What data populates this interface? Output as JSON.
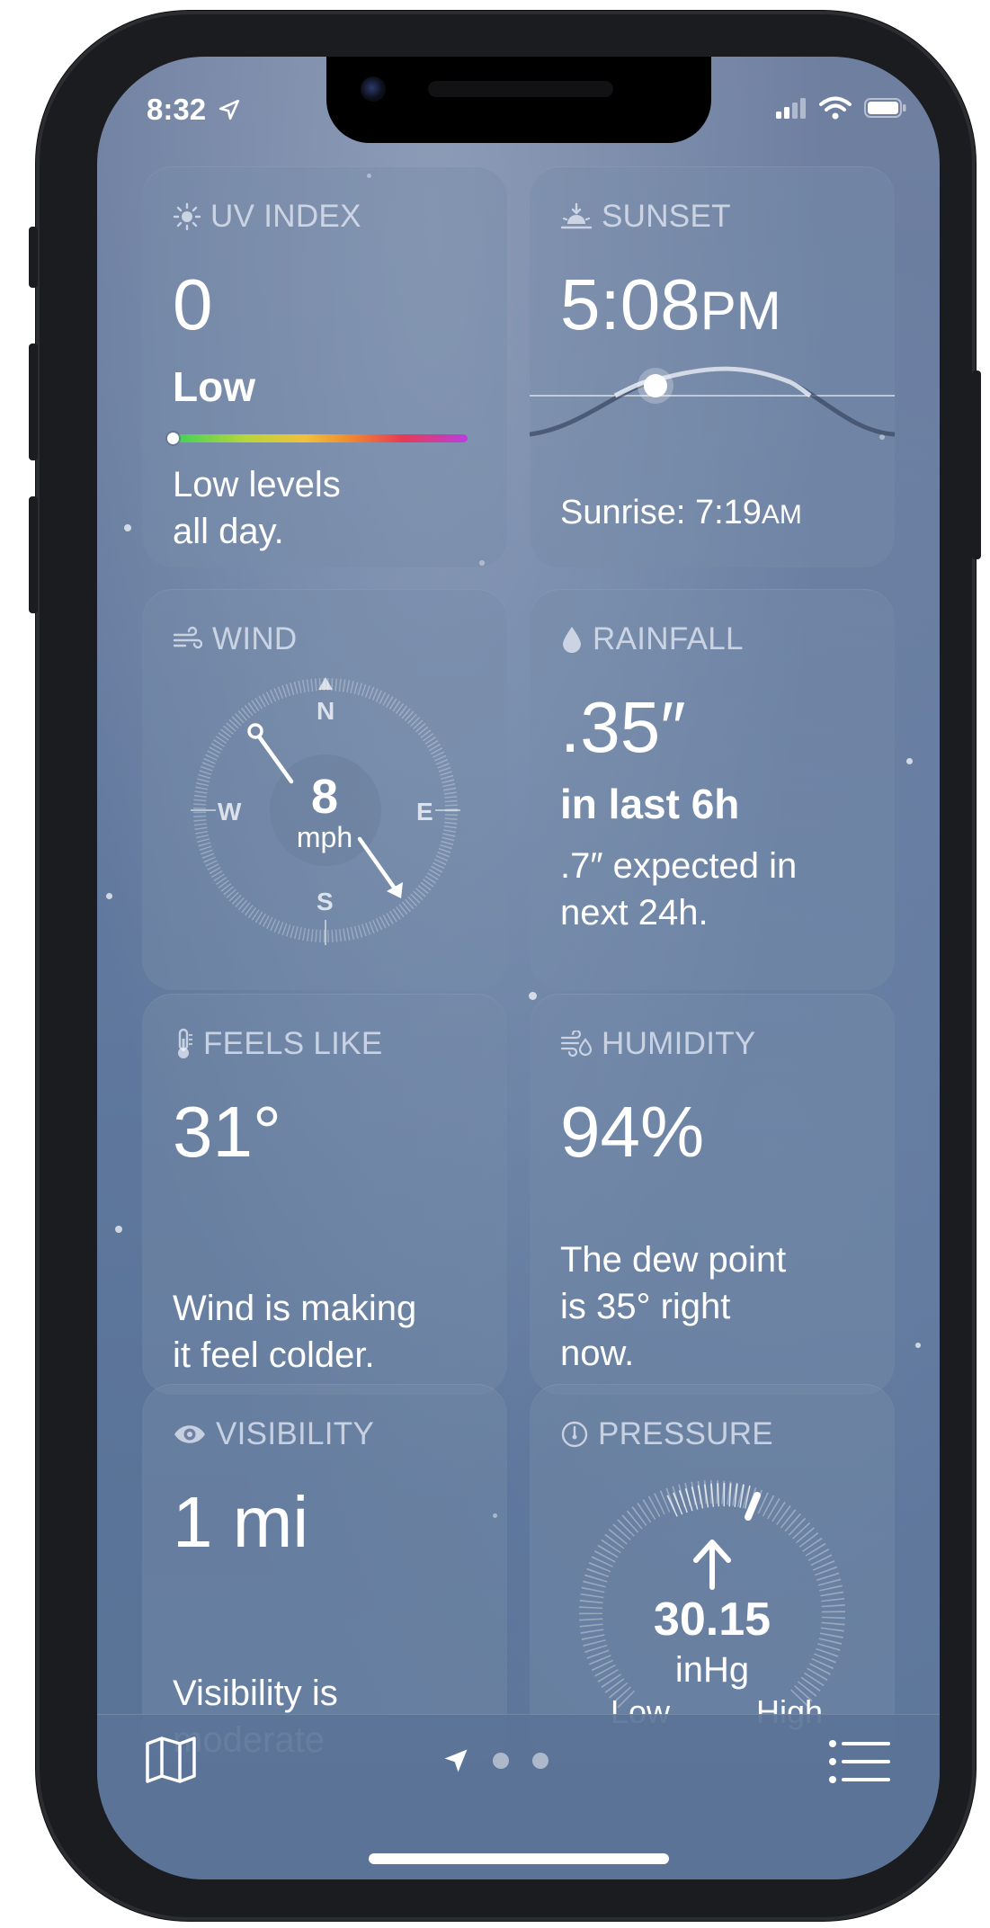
{
  "status_bar": {
    "time": "8:32"
  },
  "uv_index": {
    "title": "UV INDEX",
    "value": "0",
    "level": "Low",
    "description_line1": "Low levels",
    "description_line2": "all day.",
    "icon": "sun-icon",
    "scale_level": 0.0
  },
  "sunset": {
    "title": "SUNSET",
    "time": "5:08",
    "time_suffix": "PM",
    "sunrise_label": "Sunrise: 7:19",
    "sunrise_suffix": "AM",
    "icon": "sunset-icon"
  },
  "wind": {
    "title": "WIND",
    "speed": "8",
    "unit": "mph",
    "compass": {
      "n": "N",
      "e": "E",
      "s": "S",
      "w": "W"
    },
    "icon": "wind-icon"
  },
  "rainfall": {
    "title": "RAINFALL",
    "value": ".35″",
    "period": "in last 6h",
    "description_line1": ".7″ expected in",
    "description_line2": "next 24h.",
    "icon": "raindrop-icon"
  },
  "feels_like": {
    "title": "FEELS LIKE",
    "value": "31°",
    "description_line1": "Wind is making",
    "description_line2": "it feel colder.",
    "icon": "thermometer-icon"
  },
  "humidity": {
    "title": "HUMIDITY",
    "value": "94%",
    "description_line1": "The dew point",
    "description_line2": "is 35° right",
    "description_line3": "now.",
    "icon": "humidity-icon"
  },
  "visibility": {
    "title": "VISIBILITY",
    "value": "1 mi",
    "description_line1": "Visibility is",
    "description_line2": "moderate",
    "icon": "eye-icon"
  },
  "pressure": {
    "title": "PRESSURE",
    "value": "30.15",
    "unit": "inHg",
    "low_label": "Low",
    "high_label": "High",
    "icon": "gauge-icon"
  },
  "tabbar": {
    "map_icon": "map-icon",
    "location_icon": "location-arrow-icon",
    "list_icon": "list-icon"
  },
  "colors": {
    "card_bg": "rgba(120,140,170,0.42)",
    "header_text": "#dfe6f2",
    "uv_gradient": [
      "#3ad25a",
      "#f2d13a",
      "#f08a2e",
      "#e83a55",
      "#b93ee0"
    ]
  }
}
